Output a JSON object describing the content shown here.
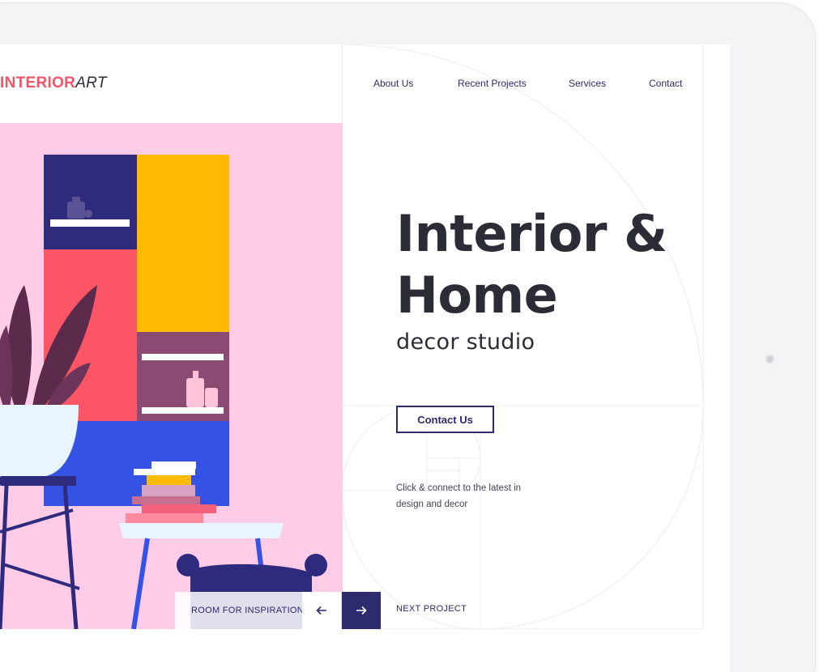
{
  "brand": {
    "part1": "INTERIOR",
    "part2": "ART"
  },
  "nav": [
    {
      "label": "About Us"
    },
    {
      "label": "Recent Projects"
    },
    {
      "label": "Services"
    },
    {
      "label": "Contact"
    }
  ],
  "hero": {
    "title_line1": "Interior &",
    "title_line2": "Home",
    "subtitle": "decor studio",
    "cta_label": "Contact Us",
    "desc_line1": "Click & connect to the latest in",
    "desc_line2": "design and decor"
  },
  "footer": {
    "room_label": "ROOM FOR INSPIRATION",
    "prev_icon": "arrow-left-icon",
    "next_icon": "arrow-right-icon",
    "next_label": "NEXT PROJECT"
  },
  "colors": {
    "accent": "#2e2a6e",
    "brand_red": "#f25567",
    "text_dark": "#2c2c36",
    "illustration_bg": "#ffcce8"
  }
}
